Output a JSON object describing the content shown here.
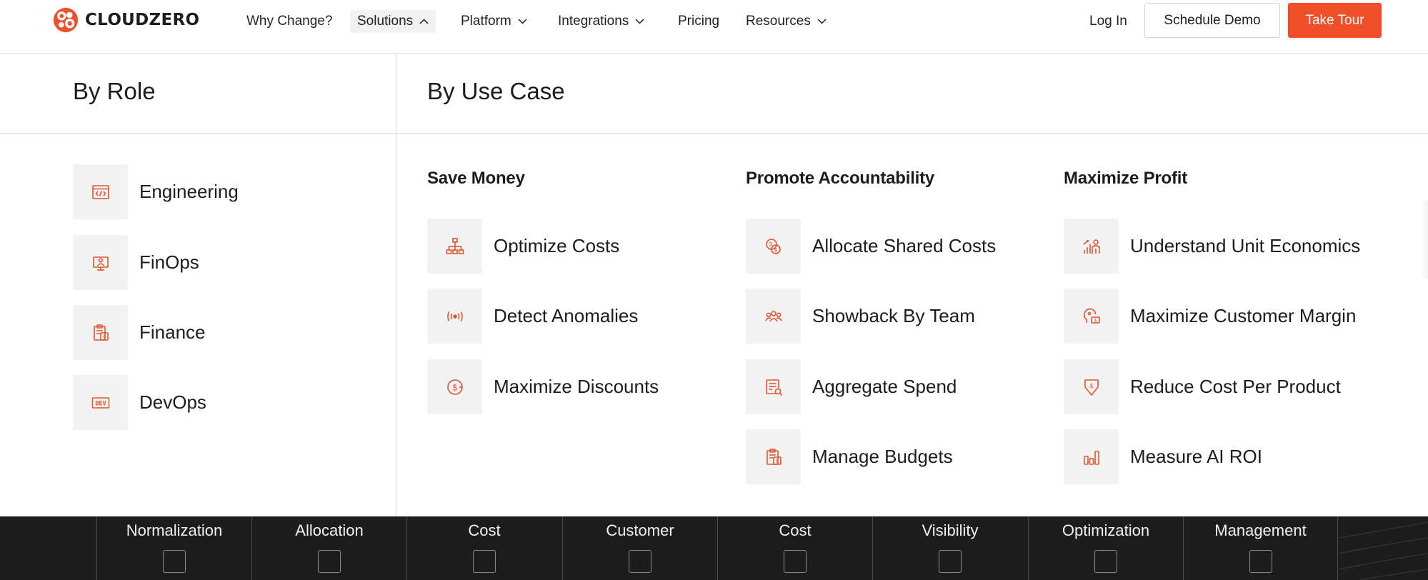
{
  "brand": {
    "name": "CLOUDZERO",
    "accent": "#f14e2a"
  },
  "nav": {
    "items": [
      {
        "label": "Why Change?",
        "dropdown": false,
        "active": false
      },
      {
        "label": "Solutions",
        "dropdown": true,
        "active": true,
        "open": true
      },
      {
        "label": "Platform",
        "dropdown": true,
        "active": false
      },
      {
        "label": "Integrations",
        "dropdown": true,
        "active": false
      },
      {
        "label": "Pricing",
        "dropdown": false,
        "active": false
      },
      {
        "label": "Resources",
        "dropdown": true,
        "active": false
      }
    ],
    "login": "Log In",
    "demo": "Schedule Demo",
    "tour": "Take Tour"
  },
  "mega": {
    "by_role": {
      "title": "By Role",
      "items": [
        {
          "label": "Engineering",
          "icon": "code-window-icon"
        },
        {
          "label": "FinOps",
          "icon": "monitor-person-icon"
        },
        {
          "label": "Finance",
          "icon": "clipboard-dollar-icon"
        },
        {
          "label": "DevOps",
          "icon": "dev-badge-icon"
        }
      ]
    },
    "by_use_case": {
      "title": "By Use Case",
      "columns": [
        {
          "heading": "Save Money",
          "items": [
            {
              "label": "Optimize Costs",
              "icon": "hierarchy-icon"
            },
            {
              "label": "Detect Anomalies",
              "icon": "signal-icon"
            },
            {
              "label": "Maximize Discounts",
              "icon": "discount-coin-icon"
            }
          ]
        },
        {
          "heading": "Promote Accountability",
          "items": [
            {
              "label": "Allocate Shared Costs",
              "icon": "coins-split-icon"
            },
            {
              "label": "Showback By Team",
              "icon": "team-icon"
            },
            {
              "label": "Aggregate Spend",
              "icon": "report-search-icon"
            },
            {
              "label": "Manage Budgets",
              "icon": "budget-clipboard-icon"
            }
          ]
        },
        {
          "heading": "Maximize Profit",
          "items": [
            {
              "label": "Understand Unit Economics",
              "icon": "unit-economics-icon"
            },
            {
              "label": "Maximize Customer Margin",
              "icon": "customer-margin-icon"
            },
            {
              "label": "Reduce Cost Per Product",
              "icon": "price-down-icon"
            },
            {
              "label": "Measure AI ROI",
              "icon": "bar-chart-icon"
            }
          ]
        }
      ]
    }
  },
  "strip": {
    "labels": [
      "Normalization",
      "Allocation",
      "Cost",
      "Customer",
      "Cost",
      "Visibility",
      "Optimization",
      "Management"
    ]
  }
}
